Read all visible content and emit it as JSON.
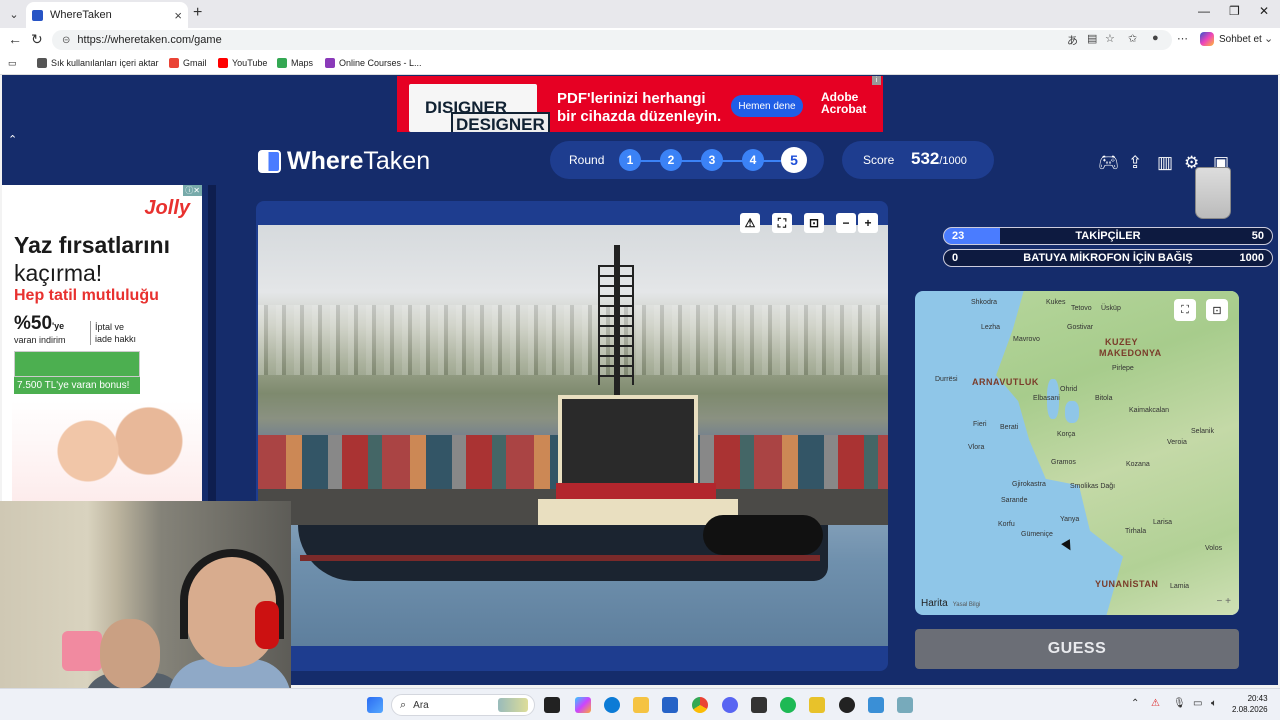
{
  "browser": {
    "tab_title": "WhereTaken",
    "url": "https://wheretaken.com/game",
    "new_tab_icon": "+",
    "copilot_label": "Sohbet et",
    "bookmarks": [
      {
        "label": "Sık kullanılanları içeri aktar",
        "color": "#555"
      },
      {
        "label": "Gmail",
        "color": "#ea4335"
      },
      {
        "label": "YouTube",
        "color": "#ff0000"
      },
      {
        "label": "Maps",
        "color": "#34a853"
      },
      {
        "label": "Online Courses - L...",
        "color": "#8a3ab9"
      }
    ]
  },
  "ad_top": {
    "book_title_1": "DISIGNER",
    "book_title_2": "DESIGNER",
    "text_1": "PDF'lerinizi herhangi",
    "text_2": "bir cihazda düzenleyin.",
    "cta": "Hemen dene",
    "brand_1": "Adobe",
    "brand_2": "Acrobat"
  },
  "header": {
    "logo_where": "Where",
    "logo_taken": "Taken",
    "round_label": "Round",
    "rounds": [
      "1",
      "2",
      "3",
      "4",
      "5"
    ],
    "current_round": 5,
    "score_label": "Score",
    "score": "532",
    "score_max": "/1000"
  },
  "ad_left": {
    "brand": "Jolly",
    "line1": "Yaz fırsatlarını",
    "line2": "kaçırma!",
    "line3": "Hep tatil mutluluğu",
    "pct": "%50",
    "pct_suffix": "'ye",
    "pct_sub": "varan indirim",
    "iptal": "İptal ve\niade hakkı",
    "bonus": "7.500 TL'ye varan bonus!"
  },
  "goals": [
    {
      "left": "23",
      "label": "TAKİPÇİLER",
      "right": "50",
      "progress": 0.17
    },
    {
      "left": "0",
      "label": "BATUYA MİKROFON İÇİN BAĞIŞ",
      "right": "1000",
      "progress": 0
    }
  ],
  "map": {
    "attribution": "Harita",
    "legal": "Yasal Bilgi",
    "labels": [
      {
        "t": "Shkodra",
        "cls": ""
      },
      {
        "t": "Kukes",
        "cls": ""
      },
      {
        "t": "Tetovo",
        "cls": ""
      },
      {
        "t": "Üsküp",
        "cls": ""
      },
      {
        "t": "Lezha",
        "cls": ""
      },
      {
        "t": "Gostivar",
        "cls": ""
      },
      {
        "t": "Mavrovo",
        "cls": ""
      },
      {
        "t": "KUZEY",
        "cls": "big"
      },
      {
        "t": "MAKEDONYA",
        "cls": "big"
      },
      {
        "t": "Durrësi",
        "cls": ""
      },
      {
        "t": "ARNAVUTLUK",
        "cls": "big"
      },
      {
        "t": "Ohrid",
        "cls": ""
      },
      {
        "t": "Pirlepe",
        "cls": ""
      },
      {
        "t": "Elbasani",
        "cls": ""
      },
      {
        "t": "Bitola",
        "cls": ""
      },
      {
        "t": "Kaimakcalan",
        "cls": ""
      },
      {
        "t": "Fieri",
        "cls": ""
      },
      {
        "t": "Berati",
        "cls": ""
      },
      {
        "t": "Korça",
        "cls": ""
      },
      {
        "t": "Selanik",
        "cls": ""
      },
      {
        "t": "Vlora",
        "cls": ""
      },
      {
        "t": "Veroia",
        "cls": ""
      },
      {
        "t": "Gramos",
        "cls": ""
      },
      {
        "t": "Kozana",
        "cls": ""
      },
      {
        "t": "Gjirokastra",
        "cls": ""
      },
      {
        "t": "Smolikas Dağı",
        "cls": ""
      },
      {
        "t": "Sarande",
        "cls": ""
      },
      {
        "t": "Korfu",
        "cls": ""
      },
      {
        "t": "Yanya",
        "cls": ""
      },
      {
        "t": "Larisa",
        "cls": ""
      },
      {
        "t": "Gümeniçe",
        "cls": ""
      },
      {
        "t": "Tirhala",
        "cls": ""
      },
      {
        "t": "Volos",
        "cls": ""
      },
      {
        "t": "YUNANİSTAN",
        "cls": "big"
      },
      {
        "t": "Lamia",
        "cls": ""
      }
    ]
  },
  "guess_label": "GUESS",
  "taskbar": {
    "search_placeholder": "Ara",
    "time": "20:43",
    "date": "2.08.2026"
  }
}
